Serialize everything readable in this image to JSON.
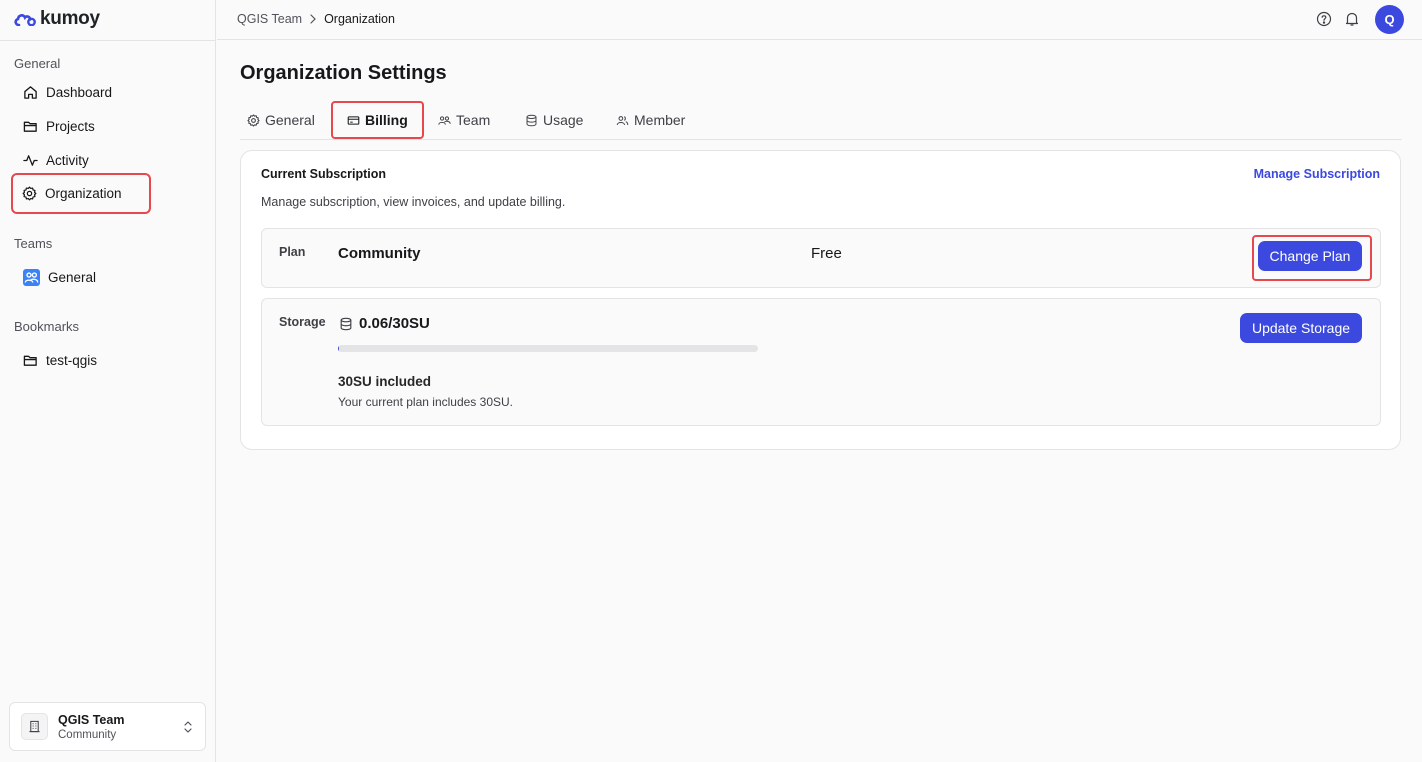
{
  "brand": {
    "name": "kumoy",
    "accent": "#3b49df",
    "highlight": "#e5484d"
  },
  "sidebar": {
    "sections": [
      {
        "label": "General"
      },
      {
        "label": "Teams"
      },
      {
        "label": "Bookmarks"
      }
    ],
    "general_items": [
      {
        "label": "Dashboard",
        "icon": "home-icon"
      },
      {
        "label": "Projects",
        "icon": "folder-icon"
      },
      {
        "label": "Activity",
        "icon": "activity-icon"
      },
      {
        "label": "Organization",
        "icon": "gear-icon",
        "selected": true
      }
    ],
    "team_items": [
      {
        "label": "General",
        "icon": "team-icon"
      }
    ],
    "bookmark_items": [
      {
        "label": "test-qgis",
        "icon": "folder-icon"
      }
    ],
    "org_switcher": {
      "name": "QGIS Team",
      "plan": "Community"
    }
  },
  "header": {
    "breadcrumb": [
      "QGIS Team",
      "Organization"
    ],
    "avatar_initial": "Q",
    "icons": [
      "help-icon",
      "bell-icon"
    ]
  },
  "main": {
    "title": "Organization Settings",
    "tabs": [
      {
        "label": "General",
        "icon": "gear-icon"
      },
      {
        "label": "Billing",
        "icon": "credit-card-icon",
        "active": true
      },
      {
        "label": "Team",
        "icon": "users-icon"
      },
      {
        "label": "Usage",
        "icon": "database-icon"
      },
      {
        "label": "Member",
        "icon": "users-icon"
      }
    ],
    "subscription": {
      "title": "Current Subscription",
      "manage_link": "Manage Subscription",
      "description": "Manage subscription, view invoices, and update billing.",
      "plan": {
        "label": "Plan",
        "name": "Community",
        "price": "Free",
        "button": "Change Plan"
      },
      "storage": {
        "label": "Storage",
        "value": "0.06/30SU",
        "used_fraction": 0.002,
        "button": "Update Storage",
        "included_title": "30SU included",
        "included_desc": "Your current plan includes 30SU."
      }
    }
  }
}
